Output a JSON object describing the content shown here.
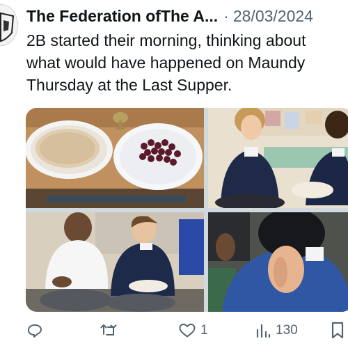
{
  "tweet": {
    "author": "The Federation ofThe A...",
    "separator": "·",
    "date": "28/03/2024",
    "text_lines": [
      "2B started their morning, thinking about",
      "what would have happened on Maundy",
      "Thursday at the Last Supper."
    ]
  },
  "media": {
    "photos": [
      {
        "icon": "bread-and-grapes-photo"
      },
      {
        "icon": "children-sitting-photo"
      },
      {
        "icon": "boys-holding-plate-photo"
      },
      {
        "icon": "child-praying-photo"
      }
    ]
  },
  "actions": {
    "reply_count": "",
    "retweet_count": "",
    "like_count": "1",
    "views_count": "130",
    "icons": [
      "reply-icon",
      "retweet-icon",
      "like-icon",
      "views-icon",
      "bookmark-icon"
    ]
  },
  "colors": {
    "text": "#0f1419",
    "secondary": "#536471",
    "background": "#ffffff"
  }
}
